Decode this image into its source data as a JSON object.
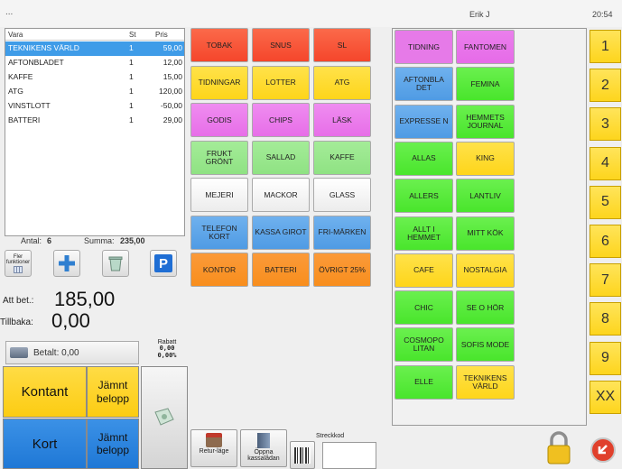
{
  "header": {
    "dots": "...",
    "user": "Erik J",
    "time": "20:54"
  },
  "items": {
    "headers": {
      "name": "Vara",
      "qty": "St",
      "price": "Pris"
    },
    "rows": [
      {
        "name": "TEKNIKENS VÄRLD",
        "qty": "1",
        "price": "59,00"
      },
      {
        "name": "AFTONBLADET",
        "qty": "1",
        "price": "12,00"
      },
      {
        "name": "KAFFE",
        "qty": "1",
        "price": "15,00"
      },
      {
        "name": "ATG",
        "qty": "1",
        "price": "120,00"
      },
      {
        "name": "VINSTLOTT",
        "qty": "1",
        "price": "-50,00"
      },
      {
        "name": "BATTERI",
        "qty": "1",
        "price": "29,00"
      }
    ]
  },
  "totals": {
    "count_label": "Antal:",
    "count": "6",
    "sum_label": "Summa:",
    "sum": "235,00"
  },
  "tools": {
    "more_functions": "Fler funktioner"
  },
  "payment": {
    "to_pay_label": "Att bet.:",
    "to_pay": "185,00",
    "change_label": "Tillbaka:",
    "change": "0,00",
    "paid_label": "Betalt: 0,00",
    "discount_label": "Rabatt",
    "discount_amount": "0,00",
    "discount_pct": "0,00%",
    "cash": "Kontant",
    "card": "Kort",
    "even_amount": "Jämnt belopp"
  },
  "categories": [
    {
      "label": "TOBAK",
      "color": "red"
    },
    {
      "label": "SNUS",
      "color": "red"
    },
    {
      "label": "SL",
      "color": "red"
    },
    {
      "label": "TIDNINGAR",
      "color": "yel"
    },
    {
      "label": "LOTTER",
      "color": "yel"
    },
    {
      "label": "ATG",
      "color": "yel"
    },
    {
      "label": "GODIS",
      "color": "pink"
    },
    {
      "label": "CHIPS",
      "color": "pink"
    },
    {
      "label": "LÄSK",
      "color": "pink"
    },
    {
      "label": "FRUKT GRÖNT",
      "color": "lgreen"
    },
    {
      "label": "SALLAD",
      "color": "lgreen"
    },
    {
      "label": "KAFFE",
      "color": "lgreen"
    },
    {
      "label": "MEJERI",
      "color": "white"
    },
    {
      "label": "MACKOR",
      "color": "white"
    },
    {
      "label": "GLASS",
      "color": "white"
    },
    {
      "label": "TELEFON KORT",
      "color": "blue"
    },
    {
      "label": "KASSA GIROT",
      "color": "blue"
    },
    {
      "label": "FRI-MÄRKEN",
      "color": "blue"
    },
    {
      "label": "KONTOR",
      "color": "orange"
    },
    {
      "label": "BATTERI",
      "color": "orange"
    },
    {
      "label": "ÖVRIGT 25%",
      "color": "orange"
    }
  ],
  "magazines": [
    {
      "label": "TIDNING",
      "color": "mag2"
    },
    {
      "label": "FANTOMEN",
      "color": "mag"
    },
    {
      "label": "AFTONBLA DET",
      "color": "blue"
    },
    {
      "label": "FEMINA",
      "color": "green"
    },
    {
      "label": "EXPRESSE N",
      "color": "blue"
    },
    {
      "label": "HEMMETS JOURNAL",
      "color": "green"
    },
    {
      "label": "ALLAS",
      "color": "green"
    },
    {
      "label": "KING",
      "color": "yel"
    },
    {
      "label": "ALLERS",
      "color": "green"
    },
    {
      "label": "LANTLIV",
      "color": "green"
    },
    {
      "label": "ALLT I HEMMET",
      "color": "green"
    },
    {
      "label": "MITT KÖK",
      "color": "green"
    },
    {
      "label": "CAFE",
      "color": "yel"
    },
    {
      "label": "NOSTALGIA",
      "color": "yel"
    },
    {
      "label": "CHIC",
      "color": "green"
    },
    {
      "label": "SE O HÖR",
      "color": "green"
    },
    {
      "label": "COSMOPO LITAN",
      "color": "green"
    },
    {
      "label": "SOFIS MODE",
      "color": "green"
    },
    {
      "label": "ELLE",
      "color": "green"
    },
    {
      "label": "TEKNIKENS VÄRLD",
      "color": "yel"
    }
  ],
  "numbers": [
    "1",
    "2",
    "3",
    "4",
    "5",
    "6",
    "7",
    "8",
    "9",
    "XX"
  ],
  "bottom": {
    "return_mode": "Retur-läge",
    "open_drawer": "Öppna kassalådan",
    "barcode_label": "Streckkod"
  }
}
